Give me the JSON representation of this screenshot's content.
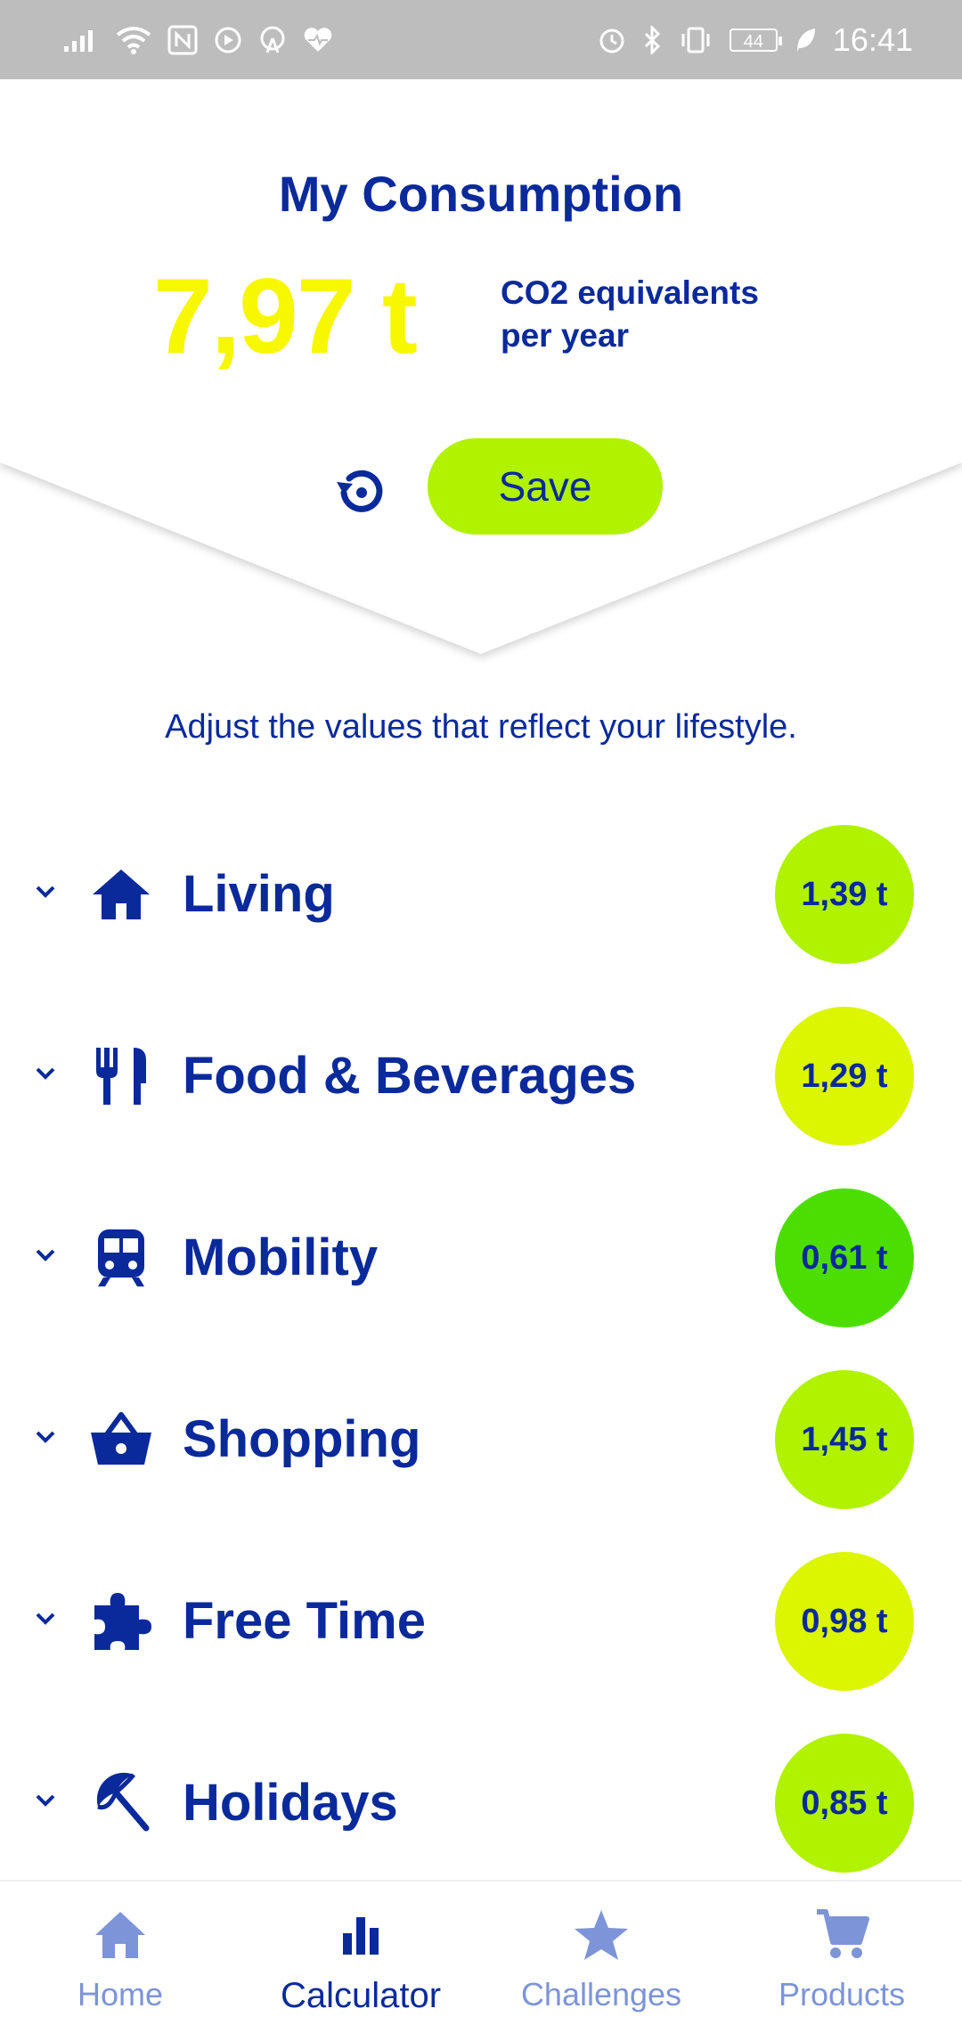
{
  "status_bar": {
    "time": "16:41",
    "battery": "44",
    "left_icons": [
      "signal-icon",
      "wifi-icon",
      "nfc-icon",
      "media-icon",
      "hotspot-icon",
      "health-icon"
    ],
    "right_icons": [
      "alarm-icon",
      "bluetooth-icon",
      "vibrate-icon",
      "battery-icon",
      "leaf-icon"
    ]
  },
  "header": {
    "title": "My Consumption",
    "total": "7,97 t",
    "unit_line1": "CO2 equivalents",
    "unit_line2": "per year",
    "reset_icon": "reset-icon",
    "save_label": "Save"
  },
  "instruction": "Adjust the values that reflect your lifestyle.",
  "categories": [
    {
      "label": "Living",
      "value": "1,39 t",
      "icon": "home-icon",
      "color": "#b0f200"
    },
    {
      "label": "Food & Beverages",
      "value": "1,29 t",
      "icon": "cutlery-icon",
      "color": "#dcf500"
    },
    {
      "label": "Mobility",
      "value": "0,61 t",
      "icon": "train-icon",
      "color": "#4cde00"
    },
    {
      "label": "Shopping",
      "value": "1,45 t",
      "icon": "basket-icon",
      "color": "#b0f200"
    },
    {
      "label": "Free Time",
      "value": "0,98 t",
      "icon": "puzzle-icon",
      "color": "#dcf500"
    },
    {
      "label": "Holidays",
      "value": "0,85 t",
      "icon": "beach-umbrella-icon",
      "color": "#b0f200"
    }
  ],
  "nav": [
    {
      "label": "Home",
      "icon": "home-icon",
      "active": false
    },
    {
      "label": "Calculator",
      "icon": "bar-chart-icon",
      "active": true
    },
    {
      "label": "Challenges",
      "icon": "star-icon",
      "active": false
    },
    {
      "label": "Products",
      "icon": "cart-icon",
      "active": false
    }
  ],
  "colors": {
    "primary": "#0a2a9b",
    "accent_yellow": "#f7f700",
    "save_green": "#b0f200",
    "nav_inactive": "#7d94d8",
    "status_bar": "#bdbdbd"
  }
}
